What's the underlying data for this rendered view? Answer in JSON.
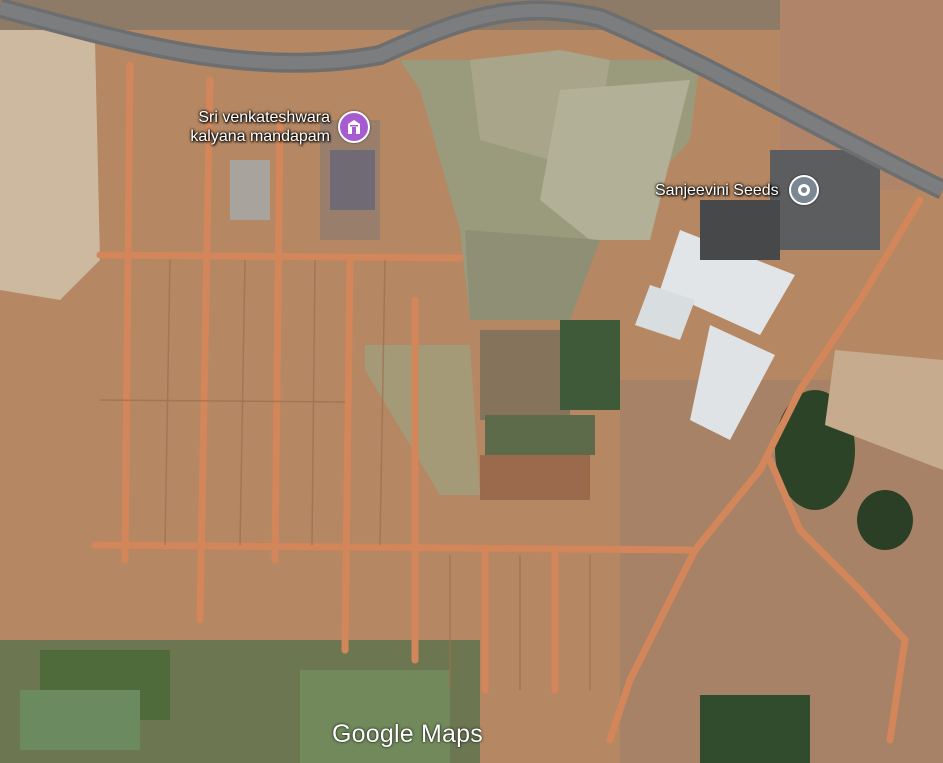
{
  "map": {
    "places": [
      {
        "name_line1": "Sri venkateshwara",
        "name_line2": "kalyana mandapam",
        "icon": "wedding-hall-icon",
        "pin_color": "#a85bd0"
      },
      {
        "name": "Sanjeevini Seeds",
        "icon": "location-pin-icon",
        "pin_color": "#7a8793"
      }
    ],
    "attribution": "Google Maps"
  }
}
